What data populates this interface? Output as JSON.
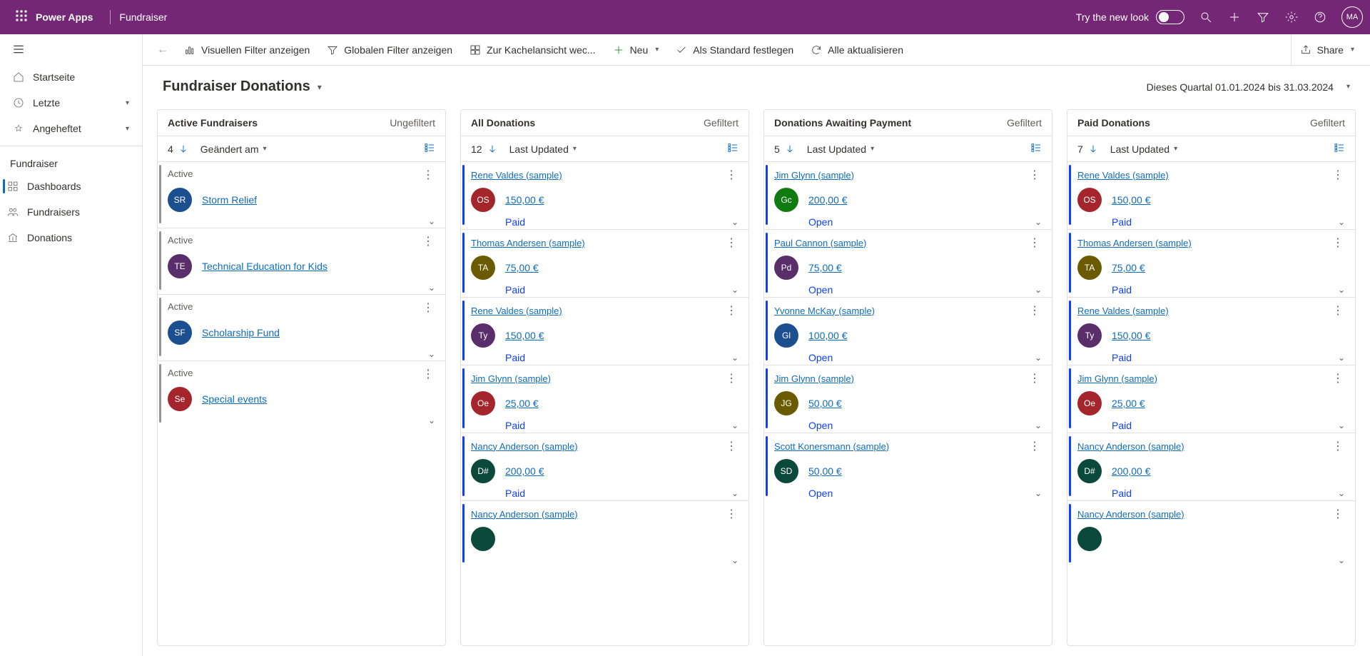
{
  "suitebar": {
    "brand": "Power Apps",
    "env": "Fundraiser",
    "try": "Try the new look",
    "avatar": "MA"
  },
  "sidebar": {
    "items": [
      {
        "label": "Startseite"
      },
      {
        "label": "Letzte",
        "chev": true
      },
      {
        "label": "Angeheftet",
        "chev": true
      }
    ],
    "group": "Fundraiser",
    "sub": [
      {
        "label": "Dashboards",
        "selected": true
      },
      {
        "label": "Fundraisers"
      },
      {
        "label": "Donations"
      }
    ]
  },
  "commands": {
    "visual": "Visuellen Filter anzeigen",
    "global": "Globalen Filter anzeigen",
    "tile": "Zur Kachelansicht wec...",
    "neu": "Neu",
    "standard": "Als Standard festlegen",
    "refresh": "Alle aktualisieren",
    "share": "Share"
  },
  "page": {
    "title": "Fundraiser Donations",
    "range": "Dieses Quartal 01.01.2024 bis 31.03.2024"
  },
  "cards": [
    {
      "title": "Active Fundraisers",
      "filter": "Ungefiltert",
      "count": "4",
      "sort": "Geändert am",
      "type": "fund",
      "rows": [
        {
          "status": "Active",
          "badge": "SR",
          "bcol": "#1b4f8f",
          "link": "Storm Relief"
        },
        {
          "status": "Active",
          "badge": "TE",
          "bcol": "#5a2d6b",
          "link": "Technical Education for Kids"
        },
        {
          "status": "Active",
          "badge": "SF",
          "bcol": "#1b4f8f",
          "link": "Scholarship Fund"
        },
        {
          "status": "Active",
          "badge": "Se",
          "bcol": "#a4262c",
          "link": "Special events"
        }
      ]
    },
    {
      "title": "All Donations",
      "filter": "Gefiltert",
      "count": "12",
      "sort": "Last Updated",
      "type": "don",
      "rows": [
        {
          "link": "Rene Valdes (sample)",
          "badge": "OS",
          "bcol": "#a4262c",
          "amount": "150,00 €",
          "status": "Paid"
        },
        {
          "link": "Thomas Andersen (sample)",
          "badge": "TA",
          "bcol": "#6b5b00",
          "amount": "75,00 €",
          "status": "Paid"
        },
        {
          "link": "Rene Valdes (sample)",
          "badge": "Ty",
          "bcol": "#5a2d6b",
          "amount": "150,00 €",
          "status": "Paid"
        },
        {
          "link": "Jim Glynn (sample)",
          "badge": "Oe",
          "bcol": "#a4262c",
          "amount": "25,00 €",
          "status": "Paid"
        },
        {
          "link": "Nancy Anderson (sample)",
          "badge": "D#",
          "bcol": "#0b4a3b",
          "amount": "200,00 €",
          "status": "Paid"
        },
        {
          "link": "Nancy Anderson (sample)",
          "badge": "",
          "bcol": "#0b4a3b",
          "amount": "",
          "status": ""
        }
      ]
    },
    {
      "title": "Donations Awaiting Payment",
      "filter": "Gefiltert",
      "count": "5",
      "sort": "Last Updated",
      "type": "don",
      "rows": [
        {
          "link": "Jim Glynn (sample)",
          "badge": "Gc",
          "bcol": "#107c10",
          "amount": "200,00 €",
          "status": "Open"
        },
        {
          "link": "Paul Cannon (sample)",
          "badge": "Pd",
          "bcol": "#5a2d6b",
          "amount": "75,00 €",
          "status": "Open"
        },
        {
          "link": "Yvonne McKay (sample)",
          "badge": "Gl",
          "bcol": "#1b4f8f",
          "amount": "100,00 €",
          "status": "Open"
        },
        {
          "link": "Jim Glynn (sample)",
          "badge": "JG",
          "bcol": "#6b5b00",
          "amount": "50,00 €",
          "status": "Open"
        },
        {
          "link": "Scott Konersmann (sample)",
          "badge": "SD",
          "bcol": "#0b4a3b",
          "amount": "50,00 €",
          "status": "Open"
        }
      ]
    },
    {
      "title": "Paid Donations",
      "filter": "Gefiltert",
      "count": "7",
      "sort": "Last Updated",
      "type": "don",
      "rows": [
        {
          "link": "Rene Valdes (sample)",
          "badge": "OS",
          "bcol": "#a4262c",
          "amount": "150,00 €",
          "status": "Paid"
        },
        {
          "link": "Thomas Andersen (sample)",
          "badge": "TA",
          "bcol": "#6b5b00",
          "amount": "75,00 €",
          "status": "Paid"
        },
        {
          "link": "Rene Valdes (sample)",
          "badge": "Ty",
          "bcol": "#5a2d6b",
          "amount": "150,00 €",
          "status": "Paid"
        },
        {
          "link": "Jim Glynn (sample)",
          "badge": "Oe",
          "bcol": "#a4262c",
          "amount": "25,00 €",
          "status": "Paid"
        },
        {
          "link": "Nancy Anderson (sample)",
          "badge": "D#",
          "bcol": "#0b4a3b",
          "amount": "200,00 €",
          "status": "Paid"
        },
        {
          "link": "Nancy Anderson (sample)",
          "badge": "",
          "bcol": "#0b4a3b",
          "amount": "",
          "status": ""
        }
      ]
    }
  ]
}
